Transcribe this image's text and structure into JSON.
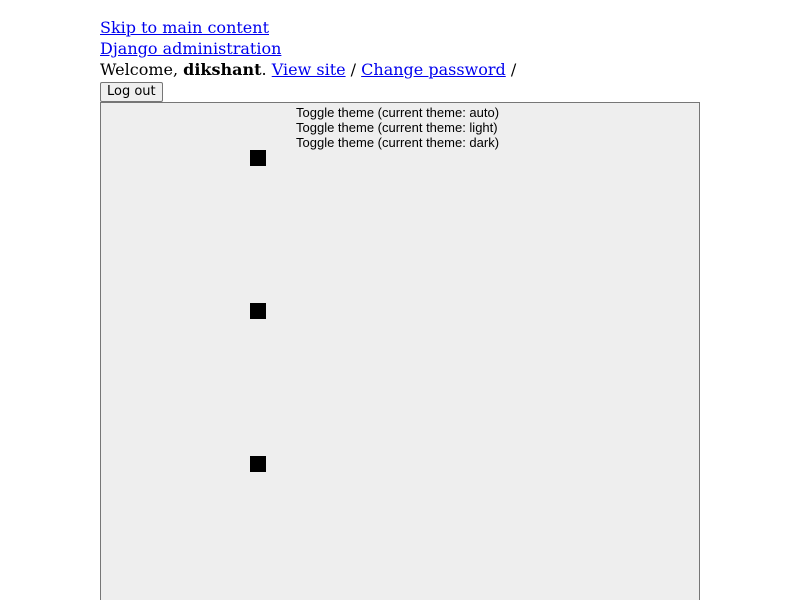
{
  "header": {
    "skip_link": "Skip to main content",
    "site_name": "Django administration"
  },
  "user_tools": {
    "welcome": "Welcome, ",
    "username": "dikshant",
    "period": ".",
    "view_site": "View site",
    "separator": " / ",
    "change_password": "Change password",
    "trailing_separator": " /",
    "logout_label": "Log out"
  },
  "theme_toggle": {
    "options": [
      "Toggle theme (current theme: auto)",
      "Toggle theme (current theme: light)",
      "Toggle theme (current theme: dark)"
    ],
    "icons": [
      "theme-auto-icon",
      "theme-light-icon",
      "theme-dark-icon"
    ]
  },
  "colors": {
    "link": "#0000ee",
    "panel_background": "#eeeeee"
  }
}
